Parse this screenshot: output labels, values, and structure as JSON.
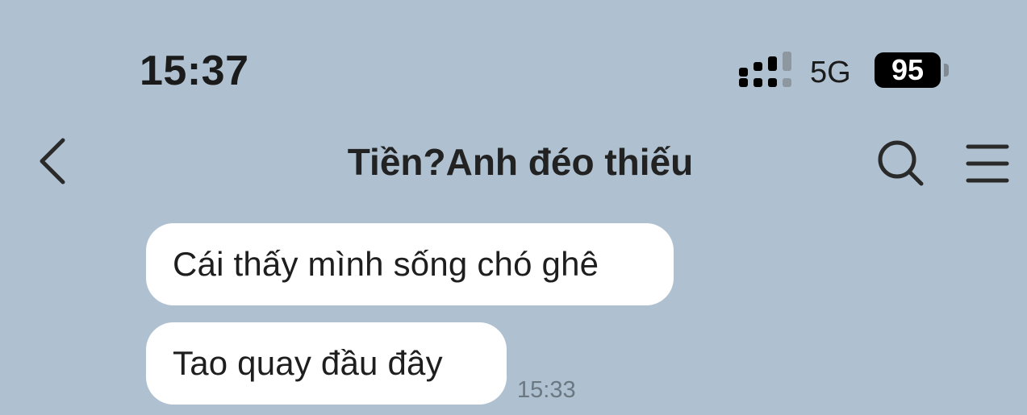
{
  "status_bar": {
    "time": "15:37",
    "network": "5G",
    "battery": "95",
    "signal_icon": "signal-bars-icon"
  },
  "header": {
    "title": "Tiền?Anh đéo thiếu",
    "back_icon": "chevron-left-icon",
    "search_icon": "search-icon",
    "menu_icon": "hamburger-menu-icon"
  },
  "messages": [
    {
      "text": "Cái thấy mình sống chó ghê"
    },
    {
      "text": "Tao quay đầu đây",
      "time": "15:33"
    }
  ],
  "colors": {
    "background": "#afc1d0",
    "bubble": "#ffffff"
  }
}
